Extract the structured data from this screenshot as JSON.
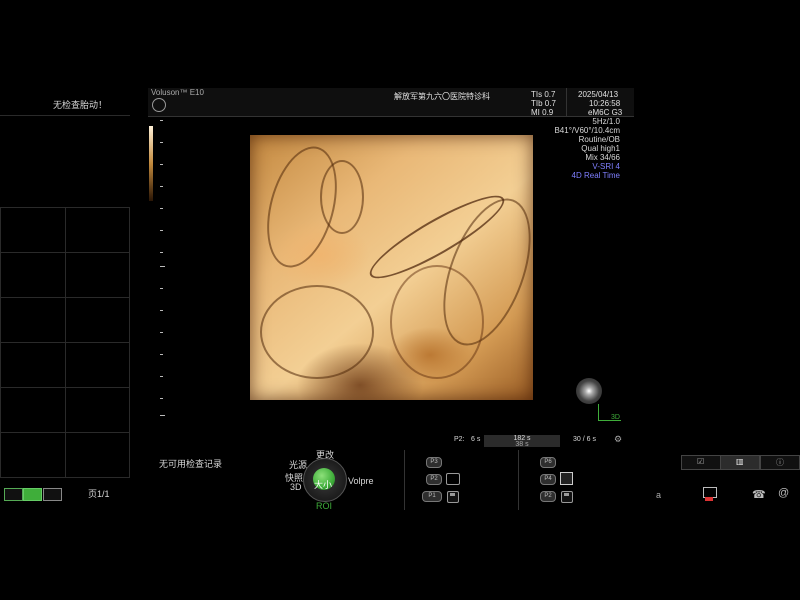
{
  "status": {
    "no_fetal_heart": "无检查胎动！",
    "no_records": "无可用检查记录",
    "page": "页1/1"
  },
  "header": {
    "logo": "Voluson™ E10",
    "hospital": "解放军第九六〇医院特诊科",
    "tis": "TIs",
    "tis_val": "0.7",
    "tib": "TIb",
    "tib_val": "0.7",
    "mi": "MI",
    "mi_val": "0.9",
    "date": "2025/04/13",
    "time": "10:26:58",
    "probe": "eM6C G3"
  },
  "scan_params": {
    "freq": "5Hz/1.0",
    "angle": "B41°/V60°/10.4cm",
    "preset": "Routine/OB",
    "quality": "Qual high1",
    "mix": "Mix 34/66",
    "vsri": "V-SRI 4",
    "mode": "4D Real Time"
  },
  "footer_bar": {
    "p2_label": "P2:",
    "p2_time": "6 s",
    "seg_top": "182 s",
    "seg_bottom": "38 s",
    "right_time": "30 / 6 s"
  },
  "three_d_label": "3D",
  "trackball": {
    "top": "更改",
    "left_top": "光源",
    "left": "快照",
    "left_bottom": "3D",
    "center": "大小",
    "right": "Volpre",
    "bottom": "ROI"
  },
  "p_buttons_mid": [
    "P3",
    "P2",
    "P1"
  ],
  "p_buttons_right": [
    "P6",
    "P4",
    "P2"
  ],
  "right_bottom": {
    "a_label": "a"
  },
  "colors": {
    "accent_green": "#3fae3a",
    "mode_blue": "#7f7fff",
    "image_orange": "#e9b877"
  }
}
